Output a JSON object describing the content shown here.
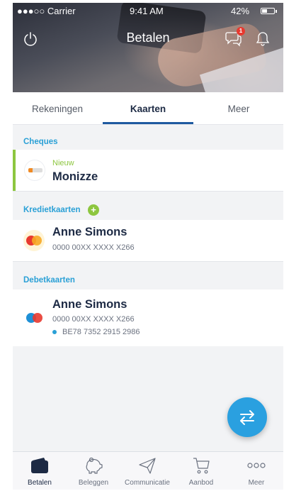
{
  "status_bar": {
    "carrier": "●●●○○ Carrier",
    "time": "9:41 AM",
    "battery": "42%"
  },
  "header": {
    "title": "Betalen",
    "notification_count": "1"
  },
  "tabs": [
    {
      "label": "Rekeningen"
    },
    {
      "label": "Kaarten",
      "active": true
    },
    {
      "label": "Meer"
    }
  ],
  "sections": {
    "cheques": {
      "label": "Cheques",
      "card": {
        "status": "Nieuw",
        "name": "Monizze"
      }
    },
    "credit": {
      "label": "Kredietkaarten",
      "card": {
        "name": "Anne Simons",
        "number": "0000 00XX XXXX X266"
      }
    },
    "debit": {
      "label": "Debetkaarten",
      "card": {
        "name": "Anne Simons",
        "number": "0000 00XX XXXX X266",
        "account": "BE78 7352 2915 2986"
      }
    }
  },
  "bottom_nav": [
    {
      "label": "Betalen",
      "icon": "wallet-icon",
      "active": true
    },
    {
      "label": "Beleggen",
      "icon": "piggy-bank-icon"
    },
    {
      "label": "Communicatie",
      "icon": "paper-plane-icon"
    },
    {
      "label": "Aanbod",
      "icon": "cart-icon"
    },
    {
      "label": "Meer",
      "icon": "more-icon"
    }
  ],
  "colors": {
    "accent_blue": "#2aa0d6",
    "accent_green": "#8dc63f",
    "tab_underline": "#1f5aa0",
    "badge_red": "#e8392f"
  }
}
